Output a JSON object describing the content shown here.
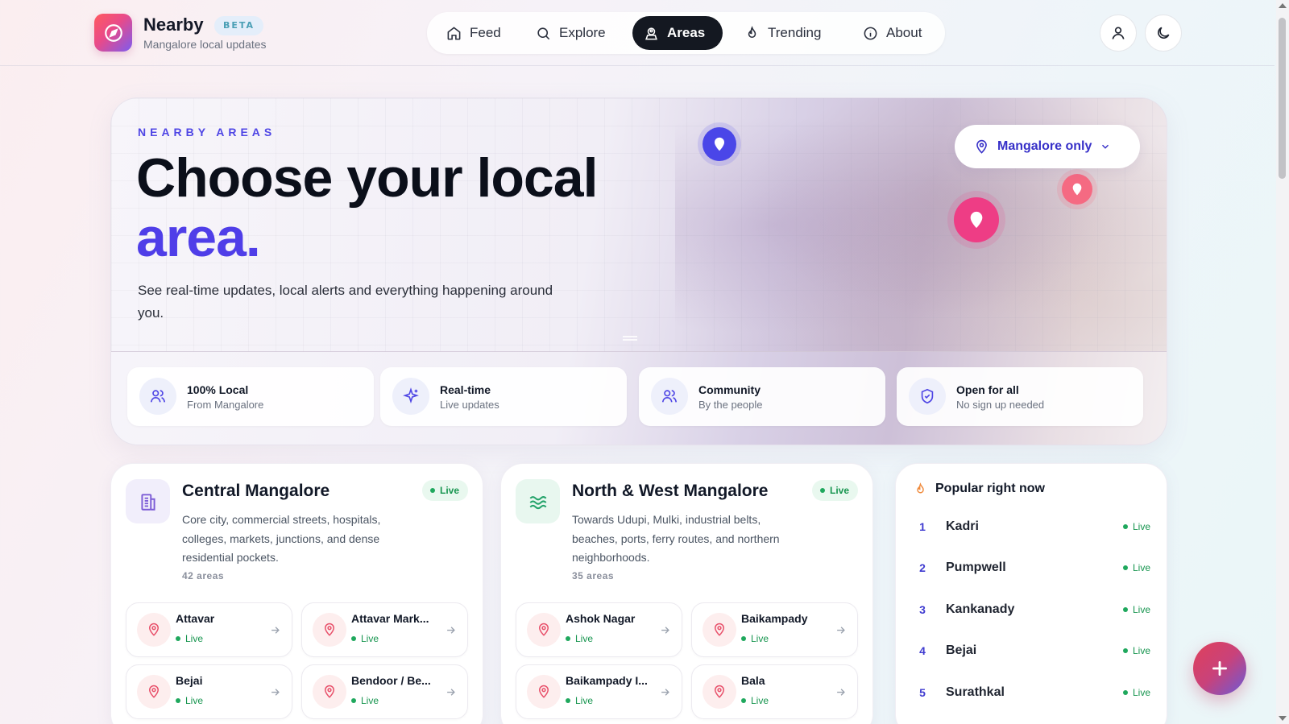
{
  "brand": {
    "name": "Nearby",
    "badge": "BETA",
    "subtitle": "Mangalore local updates"
  },
  "nav": [
    {
      "label": "Feed",
      "icon": "home-icon",
      "active": false
    },
    {
      "label": "Explore",
      "icon": "search-icon",
      "active": false
    },
    {
      "label": "Areas",
      "icon": "person-pin-icon",
      "active": true
    },
    {
      "label": "Trending",
      "icon": "flame-icon",
      "active": false
    },
    {
      "label": "About",
      "icon": "info-icon",
      "active": false
    }
  ],
  "hero": {
    "eyebrow": "NEARBY AREAS",
    "title_line1": "Choose your local",
    "title_line2": "area.",
    "description": "See real-time updates, local alerts and everything happening around you.",
    "area_select": "Mangalore only"
  },
  "features": [
    {
      "title": "100% Local",
      "subtitle": "From Mangalore",
      "icon": "users-icon"
    },
    {
      "title": "Real-time",
      "subtitle": "Live updates",
      "icon": "sparkle-icon"
    },
    {
      "title": "Community",
      "subtitle": "By the people",
      "icon": "users-icon"
    },
    {
      "title": "Open for all",
      "subtitle": "No sign up needed",
      "icon": "shield-icon"
    }
  ],
  "regions": [
    {
      "title": "Central Mangalore",
      "badge": "Live",
      "description": "Core city, commercial streets, hospitals, colleges, markets, junctions, and dense residential pockets.",
      "count": "42 areas",
      "areas": [
        {
          "name": "Attavar",
          "status": "Live"
        },
        {
          "name": "Attavar Mark...",
          "status": "Live"
        },
        {
          "name": "Bejai",
          "status": "Live"
        },
        {
          "name": "Bendoor / Be...",
          "status": "Live"
        }
      ]
    },
    {
      "title": "North & West Mangalore",
      "badge": "Live",
      "description": "Towards Udupi, Mulki, industrial belts, beaches, ports, ferry routes, and northern neighborhoods.",
      "count": "35 areas",
      "areas": [
        {
          "name": "Ashok Nagar",
          "status": "Live"
        },
        {
          "name": "Baikampady",
          "status": "Live"
        },
        {
          "name": "Baikampady I...",
          "status": "Live"
        },
        {
          "name": "Bala",
          "status": "Live"
        }
      ]
    }
  ],
  "popular": {
    "title": "Popular right now",
    "items": [
      {
        "rank": "1",
        "name": "Kadri",
        "status": "Live"
      },
      {
        "rank": "2",
        "name": "Pumpwell",
        "status": "Live"
      },
      {
        "rank": "3",
        "name": "Kankanady",
        "status": "Live"
      },
      {
        "rank": "4",
        "name": "Bejai",
        "status": "Live"
      },
      {
        "rank": "5",
        "name": "Surathkal",
        "status": "Live"
      }
    ]
  },
  "colors": {
    "accent": "#4f3ee8",
    "live": "#17954f",
    "pin_pink": "#ee3d85",
    "nav_active": "#141821"
  }
}
